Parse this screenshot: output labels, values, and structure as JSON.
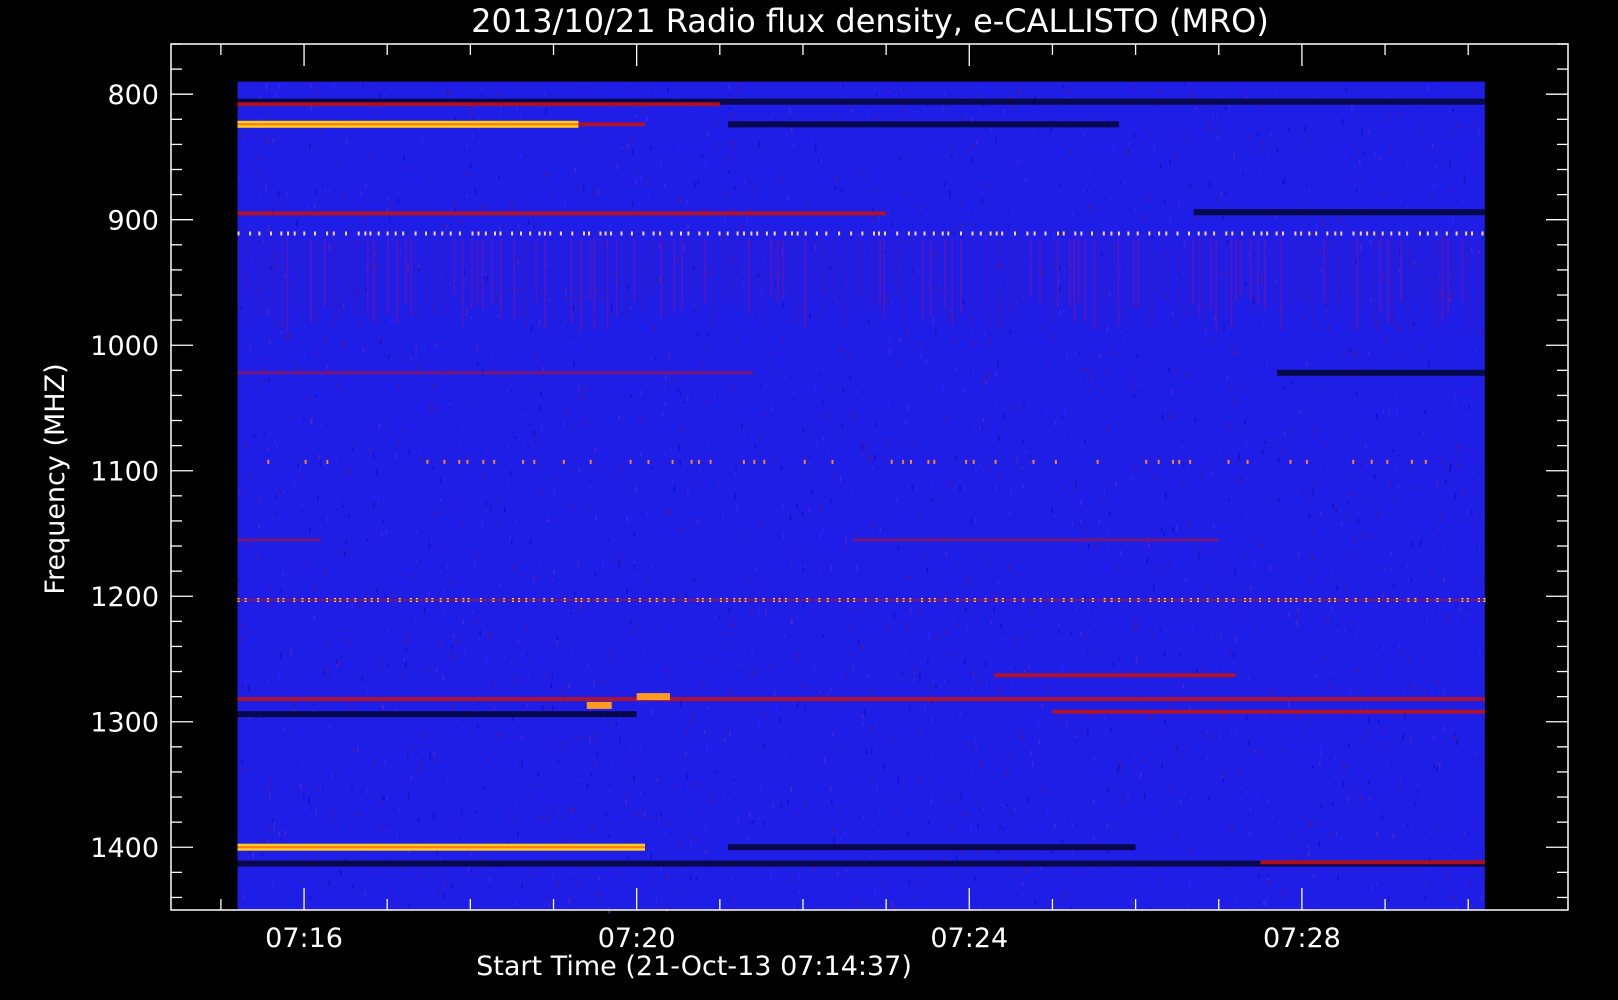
{
  "chart_data": {
    "type": "heatmap",
    "title": "2013/10/21  Radio flux density, e-CALLISTO (MRO)",
    "xlabel": "Start Time (21-Oct-13 07:14:37)",
    "ylabel": "Frequency (MHZ)",
    "x_ticks": [
      {
        "label": "07:16",
        "minute": 16
      },
      {
        "label": "07:20",
        "minute": 20
      },
      {
        "label": "07:24",
        "minute": 24
      },
      {
        "label": "07:28",
        "minute": 28
      }
    ],
    "y_ticks": [
      {
        "label": "800",
        "value": 800
      },
      {
        "label": "900",
        "value": 900
      },
      {
        "label": "1000",
        "value": 1000
      },
      {
        "label": "1100",
        "value": 1100
      },
      {
        "label": "1200",
        "value": 1200
      },
      {
        "label": "1300",
        "value": 1300
      },
      {
        "label": "1400",
        "value": 1400
      }
    ],
    "x_range_minutes": [
      14.4,
      31.2
    ],
    "y_range_mhz": [
      760,
      1450
    ],
    "y_reversed": true,
    "data_range_minutes": [
      15.2,
      30.2
    ],
    "data_range_mhz": [
      790,
      1450
    ],
    "colormap": [
      "#000000",
      "#2a00b0",
      "#0000ff",
      "#7a0080",
      "#d40000",
      "#ff8000",
      "#ffff40"
    ],
    "background_color": "#1e1ee6",
    "bands": [
      {
        "mhz": 806,
        "from": 15.2,
        "to": 30.2,
        "level": "dark"
      },
      {
        "mhz": 808,
        "from": 15.2,
        "to": 21.0,
        "level": "red"
      },
      {
        "mhz": 824,
        "from": 15.2,
        "to": 19.3,
        "level": "yellow"
      },
      {
        "mhz": 824,
        "from": 19.3,
        "to": 20.1,
        "level": "red"
      },
      {
        "mhz": 824,
        "from": 21.1,
        "to": 25.8,
        "level": "dark"
      },
      {
        "mhz": 895,
        "from": 15.2,
        "to": 23.0,
        "level": "red"
      },
      {
        "mhz": 894,
        "from": 26.7,
        "to": 30.2,
        "level": "dark"
      },
      {
        "mhz": 911,
        "from": 15.2,
        "to": 30.2,
        "level": "dotted"
      },
      {
        "mhz": 1022,
        "from": 15.2,
        "to": 21.4,
        "level": "faint-red"
      },
      {
        "mhz": 1022,
        "from": 27.7,
        "to": 30.2,
        "level": "dark"
      },
      {
        "mhz": 1093,
        "from": 15.2,
        "to": 29.6,
        "level": "dotted-red"
      },
      {
        "mhz": 1155,
        "from": 15.2,
        "to": 16.2,
        "level": "faint-red"
      },
      {
        "mhz": 1155,
        "from": 22.6,
        "to": 27.0,
        "level": "faint-red"
      },
      {
        "mhz": 1203,
        "from": 15.2,
        "to": 30.2,
        "level": "dotted-yellow"
      },
      {
        "mhz": 1263,
        "from": 24.3,
        "to": 27.2,
        "level": "red"
      },
      {
        "mhz": 1282,
        "from": 15.2,
        "to": 30.2,
        "level": "red"
      },
      {
        "mhz": 1287,
        "from": 19.4,
        "to": 19.7,
        "level": "orange"
      },
      {
        "mhz": 1280,
        "from": 20.0,
        "to": 20.4,
        "level": "orange"
      },
      {
        "mhz": 1294,
        "from": 15.2,
        "to": 20.0,
        "level": "dark"
      },
      {
        "mhz": 1292,
        "from": 25.0,
        "to": 30.2,
        "level": "red"
      },
      {
        "mhz": 1400,
        "from": 15.2,
        "to": 20.1,
        "level": "yellow"
      },
      {
        "mhz": 1400,
        "from": 21.1,
        "to": 26.0,
        "level": "dark"
      },
      {
        "mhz": 1413,
        "from": 15.2,
        "to": 30.2,
        "level": "dark"
      },
      {
        "mhz": 1412,
        "from": 27.5,
        "to": 30.2,
        "level": "red"
      }
    ]
  }
}
